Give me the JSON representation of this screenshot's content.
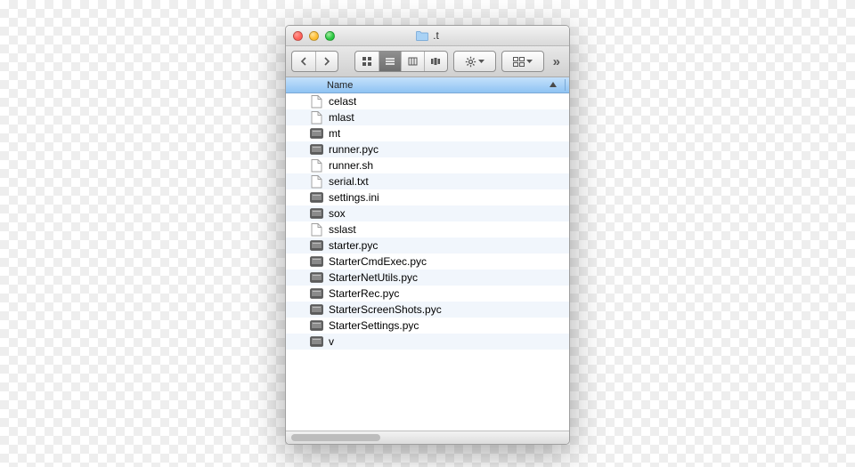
{
  "window": {
    "title": ".t"
  },
  "columns": {
    "name": "Name"
  },
  "files": [
    {
      "name": "celast",
      "kind": "file"
    },
    {
      "name": "mlast",
      "kind": "file"
    },
    {
      "name": "mt",
      "kind": "binary"
    },
    {
      "name": "runner.pyc",
      "kind": "binary"
    },
    {
      "name": "runner.sh",
      "kind": "file"
    },
    {
      "name": "serial.txt",
      "kind": "file"
    },
    {
      "name": "settings.ini",
      "kind": "binary"
    },
    {
      "name": "sox",
      "kind": "binary"
    },
    {
      "name": "sslast",
      "kind": "file"
    },
    {
      "name": "starter.pyc",
      "kind": "binary"
    },
    {
      "name": "StarterCmdExec.pyc",
      "kind": "binary"
    },
    {
      "name": "StarterNetUtils.pyc",
      "kind": "binary"
    },
    {
      "name": "StarterRec.pyc",
      "kind": "binary"
    },
    {
      "name": "StarterScreenShots.pyc",
      "kind": "binary"
    },
    {
      "name": "StarterSettings.pyc",
      "kind": "binary"
    },
    {
      "name": "v",
      "kind": "binary"
    }
  ]
}
